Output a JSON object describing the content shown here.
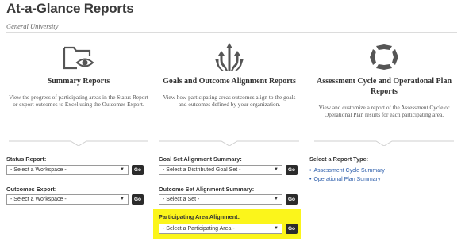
{
  "header": {
    "title": "At-a-Glance Reports",
    "subtitle": "General University"
  },
  "columns": [
    {
      "icon": "folder-eye-icon",
      "title": "Summary Reports",
      "description": "View the progress of participating areas in the Status Report or export outcomes to Excel using the Outcomes Export."
    },
    {
      "icon": "converging-arrows-icon",
      "title": "Goals and Outcome Alignment Reports",
      "description": "View how participating areas outcomes align to the goals and outcomes defined by your organization."
    },
    {
      "icon": "cycle-icon",
      "title": "Assessment Cycle and Operational Plan Reports",
      "description": "View and customize a report of the Assessment Cycle or Operational Plan results for each participating area."
    }
  ],
  "summary_fields": {
    "status_label": "Status Report:",
    "status_select": "- Select a Workspace -",
    "outcomes_label": "Outcomes Export:",
    "outcomes_select": "- Select a Workspace -"
  },
  "alignment_fields": {
    "goal_set_label": "Goal Set Alignment Summary:",
    "goal_set_select": "- Select a Distributed Goal Set -",
    "outcome_set_label": "Outcome Set Alignment Summary:",
    "outcome_set_select": "- Select a Set -",
    "participating_label": "Participating Area Alignment:",
    "participating_select": "- Select a Participating Area -"
  },
  "go_label": "Go",
  "report_types": {
    "label": "Select a Report Type:",
    "links": [
      "Assessment Cycle Summary",
      "Operational Plan Summary"
    ]
  },
  "colors": {
    "highlight": "#fbf51b",
    "go_button": "#2b2b2b",
    "link": "#2a5caa",
    "icon": "#555555"
  }
}
